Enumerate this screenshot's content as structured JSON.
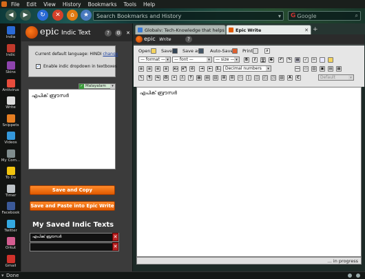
{
  "menu": [
    "File",
    "Edit",
    "View",
    "History",
    "Bookmarks",
    "Tools",
    "Help"
  ],
  "url_placeholder": "Search Bookmarks and History",
  "search_placeholder": "Google",
  "left_toolbar": [
    {
      "label": "India",
      "icon": "india-icon",
      "color": "#2a6ad6"
    },
    {
      "label": "Indic",
      "icon": "indic-icon",
      "color": "#c0392b"
    },
    {
      "label": "Skins",
      "icon": "skins-icon",
      "color": "#8e44ad"
    },
    {
      "label": "Antivirus",
      "icon": "antivirus-icon",
      "color": "#e74c3c"
    },
    {
      "label": "Write",
      "icon": "write-icon",
      "color": "#dcdcdc"
    },
    {
      "label": "Snippets",
      "icon": "snippets-icon",
      "color": "#e67e22"
    },
    {
      "label": "Videos",
      "icon": "videos-icon",
      "color": "#3498db"
    },
    {
      "label": "My Com...",
      "icon": "my-computer-icon",
      "color": "#7f8c8d"
    },
    {
      "label": "To Do",
      "icon": "todo-icon",
      "color": "#f1c40f"
    },
    {
      "label": "Timer",
      "icon": "timer-icon",
      "color": "#bdc3c7"
    },
    {
      "label": "Facebook",
      "icon": "facebook-icon",
      "color": "#3b5998"
    },
    {
      "label": "Twitter",
      "icon": "twitter-icon",
      "color": "#33a8e0"
    },
    {
      "label": "Orkut",
      "icon": "orkut-icon",
      "color": "#d35d90"
    },
    {
      "label": "Gmail",
      "icon": "gmail-icon",
      "color": "#d0322b"
    }
  ],
  "sidebar": {
    "brand": "epic",
    "title": "Indic Text",
    "lang_text": "Current default language: HINDI",
    "change_label": "change",
    "checkbox_label": "Enable indic dropdown in textboxes",
    "lang_select": "Malayalam",
    "textarea_value": "എപിക് ബ്രൗസർ",
    "save_copy": "Save and Copy",
    "save_paste": "Save and Paste into Epic Write",
    "saved_title": "My Saved Indic Texts",
    "saved_items": [
      "എപിക് ബ്രൗസർ",
      ""
    ]
  },
  "tabs": [
    {
      "label": "Globalv: Tech-Knowledge that helps",
      "icon": "globe-icon",
      "color": "#3a7bd5"
    },
    {
      "label": "Epic Write",
      "icon": "epic-icon",
      "color": "#e05a00"
    }
  ],
  "epic_write": {
    "brand": "epic",
    "title": "Write",
    "toolbar": {
      "open": "Open",
      "save": "Save",
      "save_as": "Save as",
      "auto_saved": "Auto-Saved",
      "print": "Print",
      "format": "— format —",
      "font": "— font —",
      "size": "— size —",
      "list_style": "Decimal numbers",
      "style": "Default"
    },
    "content": "എപിക് ബ്രൗസർ",
    "status": "... in progress"
  },
  "status_bar": {
    "text": "Done"
  }
}
